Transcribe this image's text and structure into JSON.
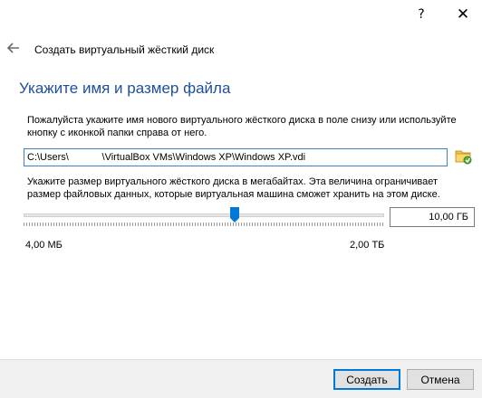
{
  "titlebar": {
    "help_label": "?",
    "close_label": "✕"
  },
  "wizard": {
    "title": "Создать виртуальный жёсткий диск",
    "back_icon": "arrow-left-icon"
  },
  "page": {
    "heading": "Укажите имя и размер файла",
    "file_description": "Пожалуйста укажите имя нового виртуального жёсткого диска в поле снизу или используйте кнопку с иконкой папки справа от него.",
    "file_path": "C:\\Users\\            \\VirtualBox VMs\\Windows XP\\Windows XP.vdi",
    "folder_icon": "folder-browse-icon",
    "size_description": "Укажите размер виртуального жёсткого диска в мегабайтах. Эта величина ограничивает размер файловых данных, которые виртуальная машина сможет хранить на этом диске.",
    "size_value": "10,00 ГБ",
    "slider_position_fraction": 0.585,
    "min_label": "4,00 МБ",
    "max_label": "2,00 ТБ"
  },
  "footer": {
    "create_label": "Создать",
    "cancel_label": "Отмена"
  },
  "colors": {
    "heading": "#1f4e9c",
    "accent": "#0078d7",
    "footer_bg": "#f0f0f0"
  }
}
